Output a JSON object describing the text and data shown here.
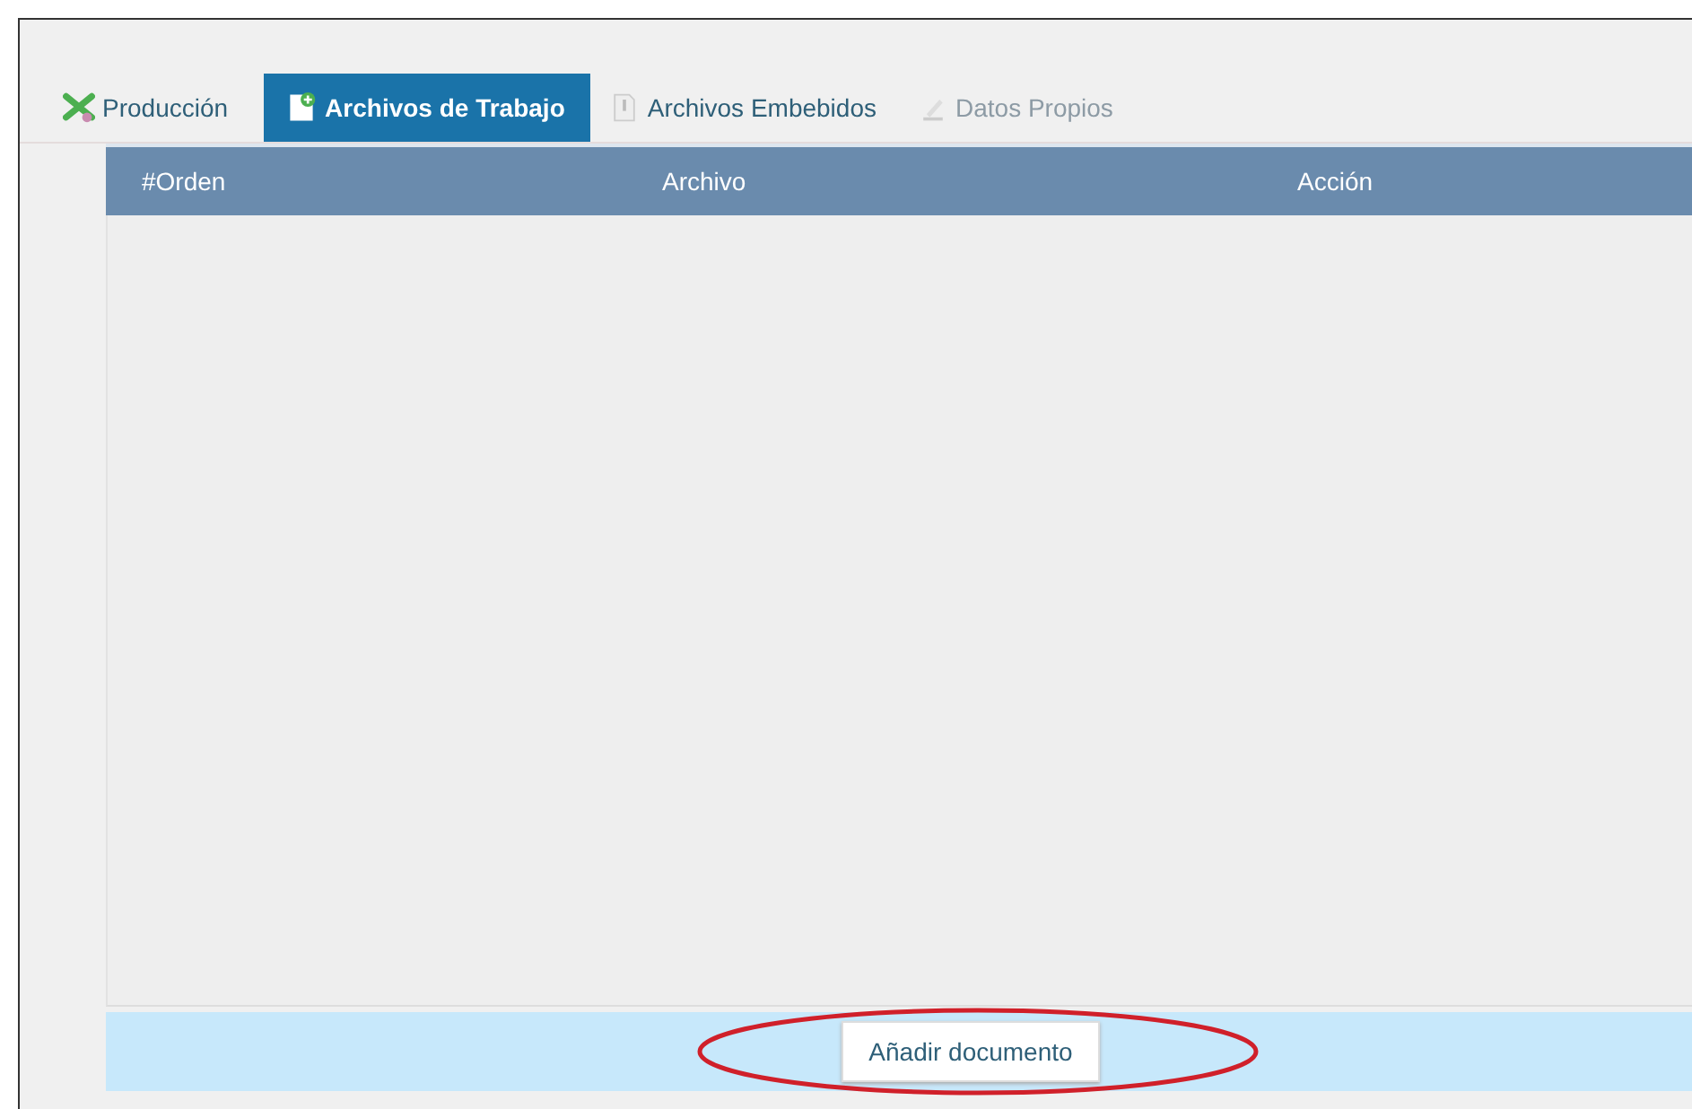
{
  "tabs": [
    {
      "label": "Producción",
      "selected": false,
      "disabled": false
    },
    {
      "label": "Archivos de Trabajo",
      "selected": true,
      "disabled": false
    },
    {
      "label": "Archivos Embebidos",
      "selected": false,
      "disabled": false
    },
    {
      "label": "Datos Propios",
      "selected": false,
      "disabled": true
    }
  ],
  "table": {
    "columns": [
      "#Orden",
      "Archivo",
      "Acción"
    ]
  },
  "footer": {
    "button": "Añadir documento"
  }
}
